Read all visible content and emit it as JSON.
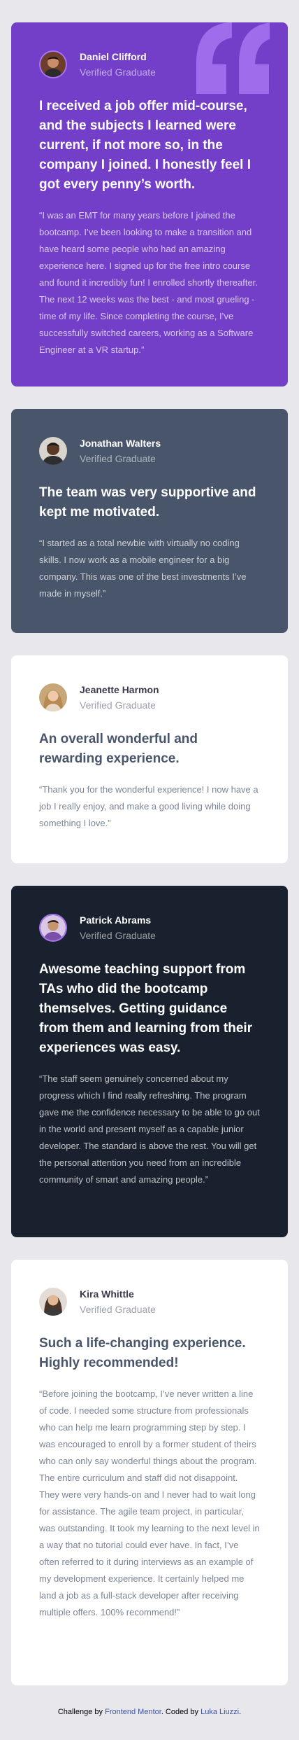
{
  "testimonials": [
    {
      "name": "Daniel Clifford",
      "role": "Verified Graduate",
      "headline": "I received a job offer mid-course, and the subjects I learned were current, if not more so, in the company I joined. I honestly feel I got every penny’s worth.",
      "body": "“I was an EMT for many years before I joined the bootcamp. I’ve been looking to make a transition and have heard some people who had an amazing experience here. I signed up for the free intro course and found it incredibly fun! I enrolled shortly thereafter. The next 12 weeks was the best - and most grueling - time of my life. Since completing the course, I’ve successfully switched careers, working as a Software Engineer at a VR startup.”",
      "bg": "#733fc8"
    },
    {
      "name": "Jonathan Walters",
      "role": "Verified Graduate",
      "headline": "The team was very supportive and kept me motivated.",
      "body": "“I started as a total newbie with virtually no coding skills. I now work as a mobile engineer for a big company. This was one of the best investments I’ve made in myself.”",
      "bg": "#48556a"
    },
    {
      "name": "Jeanette Harmon",
      "role": "Verified Graduate",
      "headline": "An overall wonderful and rewarding experience.",
      "body": "“Thank you for the wonderful experience! I now have a job I really enjoy, and make a good living while doing something I love.”",
      "bg": "#ffffff"
    },
    {
      "name": "Patrick Abrams",
      "role": "Verified Graduate",
      "headline": "Awesome teaching support from TAs who did the bootcamp themselves. Getting guidance from them and learning from their experiences was easy.",
      "body": "“The staff seem genuinely concerned about my progress which I find really refreshing. The program gave me the confidence necessary to be able to go out in the world and present myself as a capable junior developer. The standard is above the rest. You will get the personal attention you need from an incredible community of smart and amazing people.”",
      "bg": "#19212e"
    },
    {
      "name": "Kira Whittle",
      "role": "Verified Graduate",
      "headline": "Such a life-changing experience. Highly recommended!",
      "body": "“Before joining the bootcamp, I’ve never written a line of code. I needed some structure from professionals who can help me learn programming step by step. I was encouraged to enroll by a former student of theirs who can only say wonderful things about the program. The entire curriculum and staff did not disappoint. They were very hands-on and I never had to wait long for assistance. The agile team project, in particular, was outstanding. It took my learning to the next level in a way that no tutorial could ever have. In fact, I’ve often referred to it during interviews as an example of my development experience. It certainly helped me land a job as a full-stack developer after receiving multiple offers. 100% recommend!”",
      "bg": "#ffffff"
    }
  ],
  "footer": {
    "prefix": "Challenge by ",
    "link1": "Frontend Mentor",
    "middle": ". Coded by ",
    "link2": "Luka Liuzzi",
    "suffix": "."
  },
  "icons": {
    "quote": "quotation-mark-icon",
    "avatar": "avatar"
  },
  "colors": {
    "page_bg": "#e7e7ec",
    "accent_purple": "#733fc8",
    "quote_purple": "#a775f1"
  }
}
